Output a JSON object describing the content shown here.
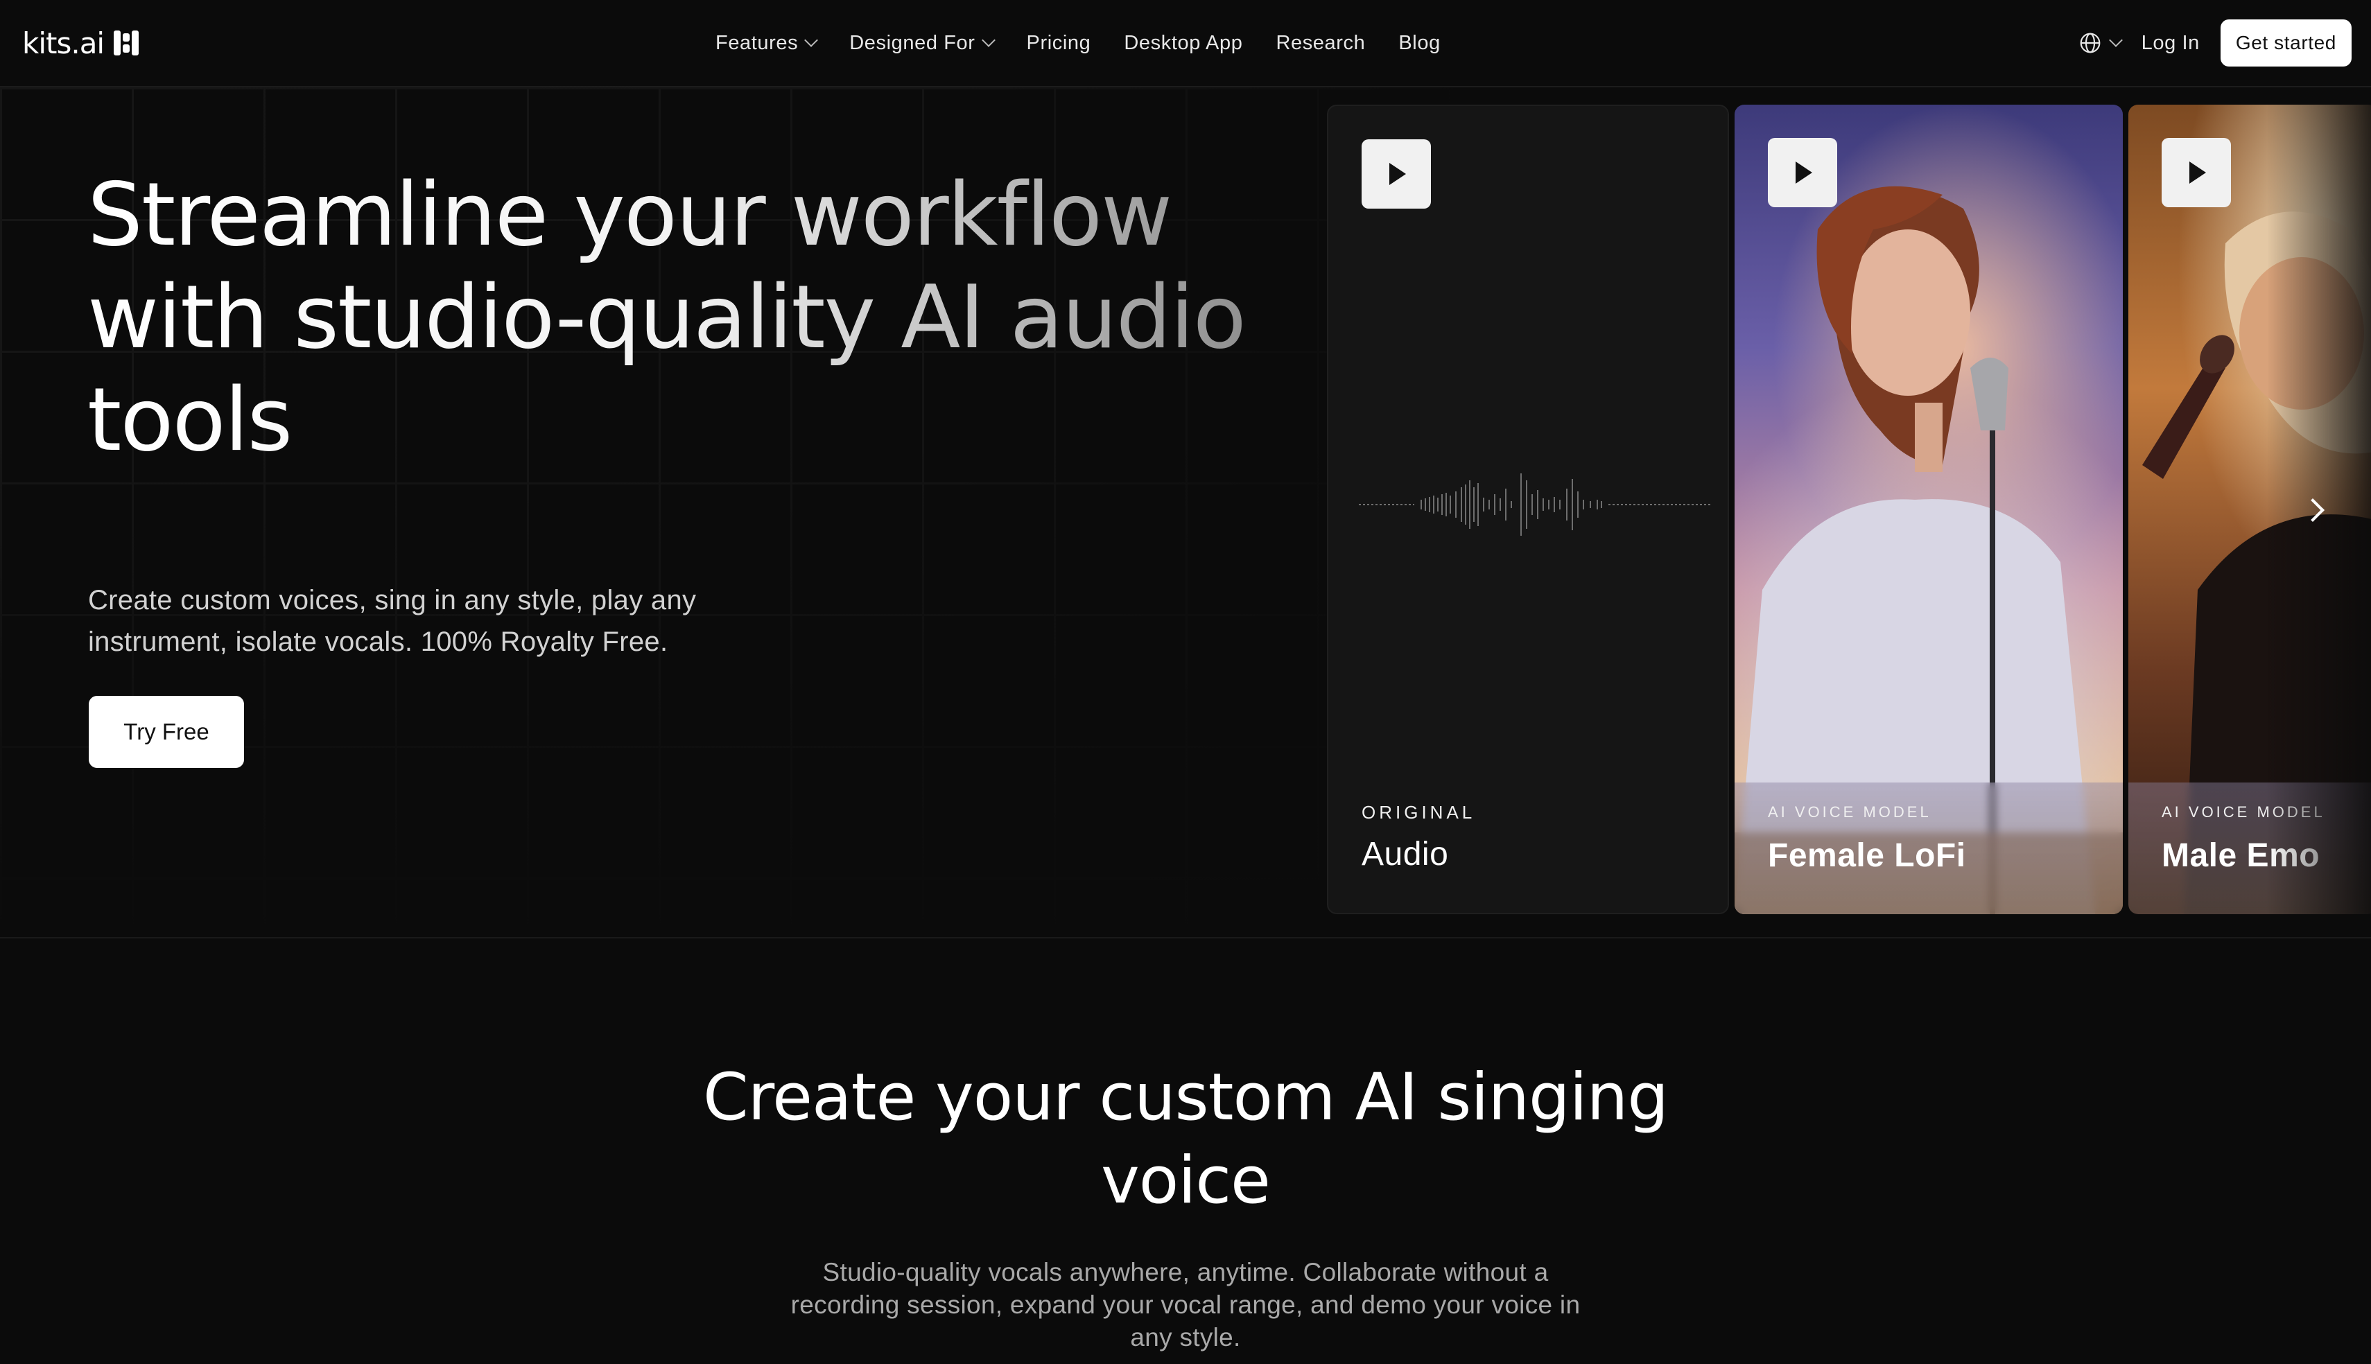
{
  "nav": {
    "logo_text": "kits.ai",
    "links": [
      {
        "label": "Features",
        "dropdown": true
      },
      {
        "label": "Designed For",
        "dropdown": true
      },
      {
        "label": "Pricing",
        "dropdown": false
      },
      {
        "label": "Desktop App",
        "dropdown": false
      },
      {
        "label": "Research",
        "dropdown": false
      },
      {
        "label": "Blog",
        "dropdown": false
      }
    ],
    "language_icon": "globe-icon",
    "login_label": "Log In",
    "cta_label": "Get started"
  },
  "hero": {
    "headline": "Streamline your workflow with studio-quality AI audio tools",
    "subtext": "Create custom voices, sing in any style, play any instrument, isolate vocals. 100% Royalty Free.",
    "cta_label": "Try Free"
  },
  "carousel": {
    "cards": [
      {
        "label": "ORIGINAL",
        "title": "Audio"
      },
      {
        "label": "AI VOICE MODEL",
        "title": "Female LoFi"
      },
      {
        "label": "AI VOICE MODEL",
        "title": "Male Emo"
      }
    ],
    "next_icon": "chevron-right-icon"
  },
  "section2": {
    "title": "Create your custom AI singing voice",
    "subtext": "Studio-quality vocals anywhere, anytime. Collaborate without a recording session, expand your vocal range, and demo your voice in any style."
  },
  "colors": {
    "background": "#0b0b0b",
    "button_bg": "#ffffff",
    "button_text": "#111111"
  }
}
